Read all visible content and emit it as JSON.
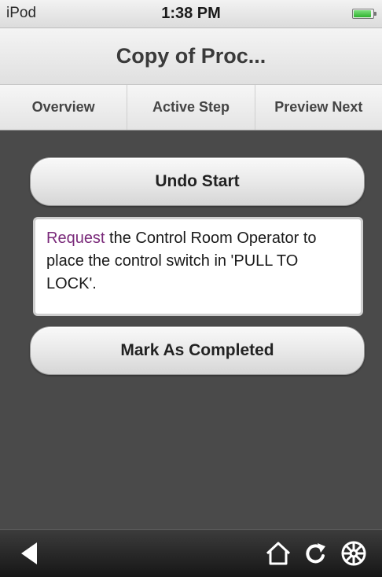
{
  "status_bar": {
    "carrier": "iPod",
    "time": "1:38 PM",
    "battery_level": 0.85,
    "battery_icon": "battery-icon"
  },
  "header": {
    "title": "Copy of Proc..."
  },
  "tabs": [
    {
      "label": "Overview"
    },
    {
      "label": "Active Step"
    },
    {
      "label": "Preview Next"
    }
  ],
  "main": {
    "undo_label": "Undo Start",
    "step": {
      "verb": "Request",
      "text": " the Control Room Operator to place the control switch in 'PULL TO LOCK'."
    },
    "complete_label": "Mark As Completed"
  },
  "toolbar": {
    "icons": [
      "back-icon",
      "home-icon",
      "refresh-icon",
      "settings-icon"
    ]
  },
  "colors": {
    "background": "#4a4a4a",
    "verb_highlight": "#7a2a7a",
    "toolbar": "#1e1e1e",
    "battery_green": "#2fb32f"
  }
}
